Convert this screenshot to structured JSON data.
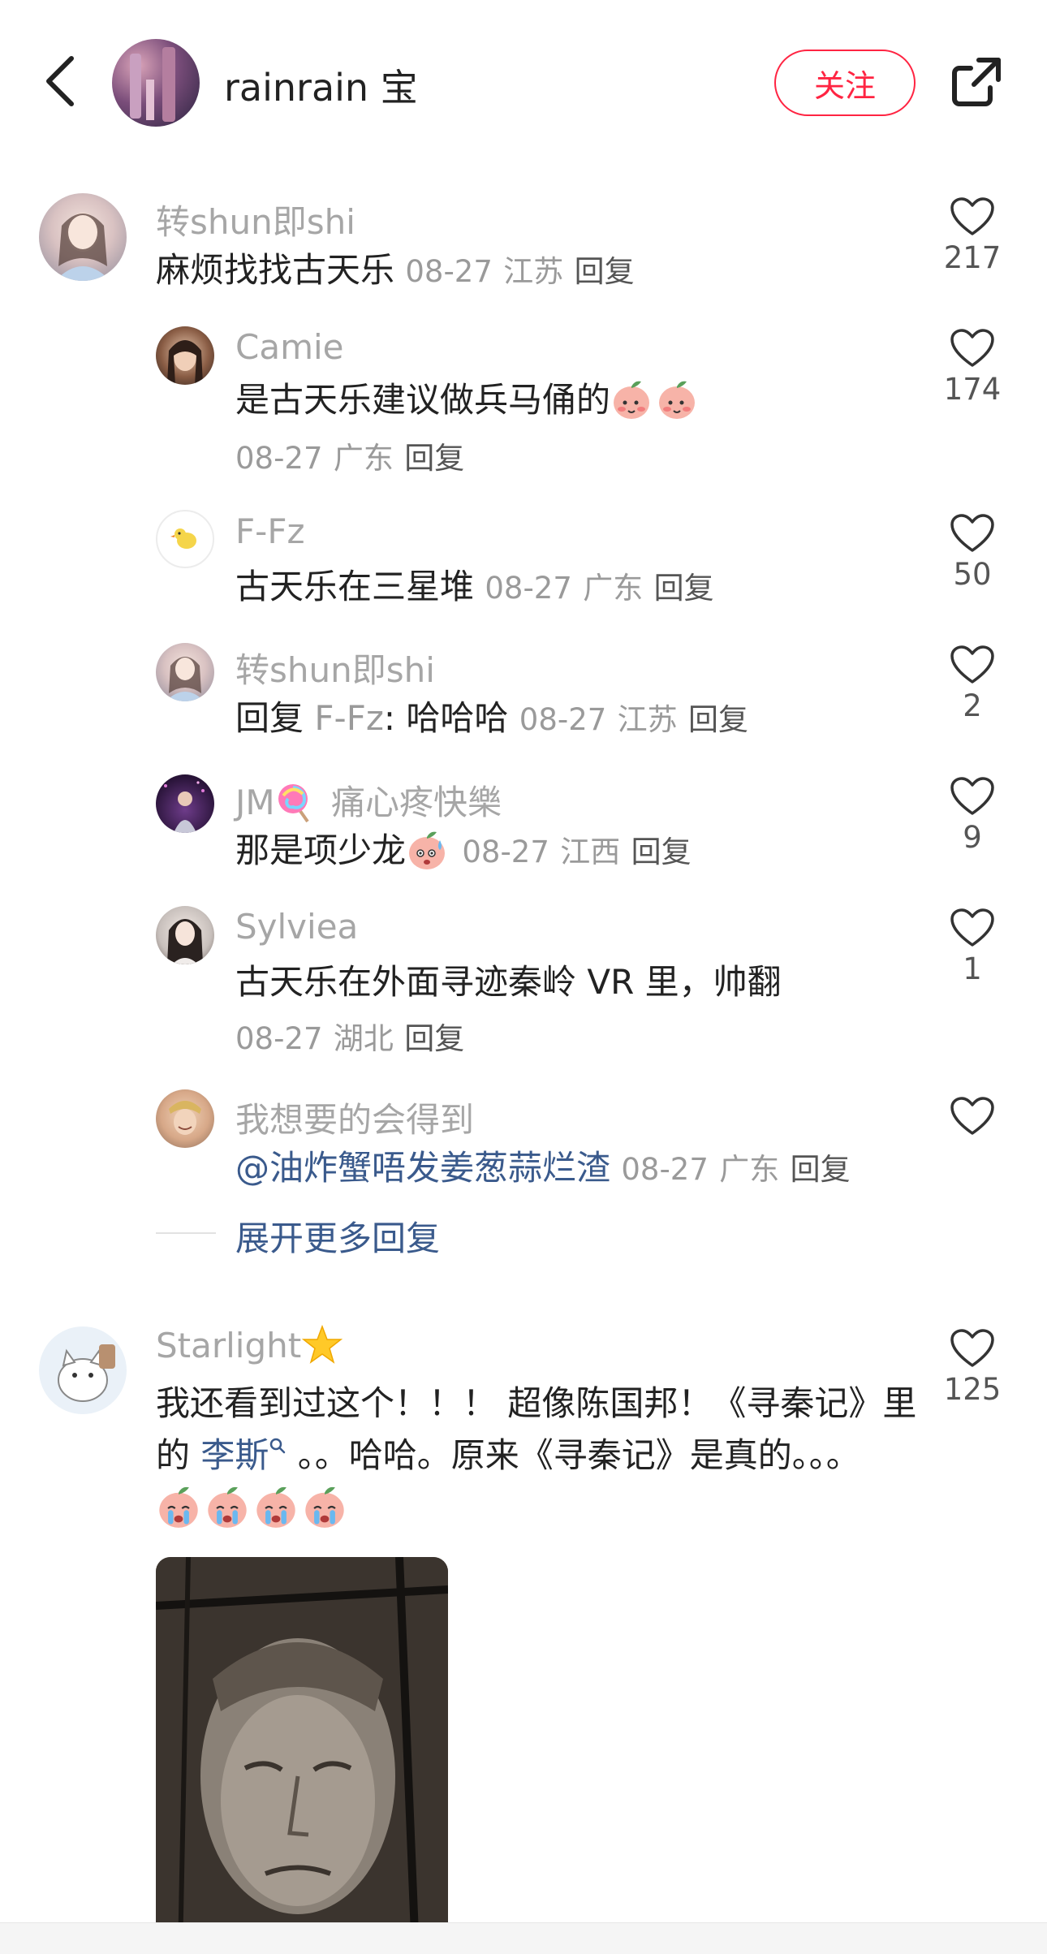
{
  "header": {
    "name": "rainrain 宝",
    "follow_label": "关注"
  },
  "comments": [
    {
      "username": "转shun即shi",
      "text": "麻烦找找古天乐",
      "date": "08-27",
      "location": "江苏",
      "reply_label": "回复",
      "likes": "217",
      "replies": [
        {
          "username": "Camie",
          "text": "是古天乐建议做兵马俑的",
          "date": "08-27",
          "location": "广东",
          "reply_label": "回复",
          "likes": "174"
        },
        {
          "username": "F-Fz",
          "text": "古天乐在三星堆",
          "date": "08-27",
          "location": "广东",
          "reply_label": "回复",
          "likes": "50"
        },
        {
          "username": "转shun即shi",
          "reply_prefix": "回复",
          "reply_target": "F-Fz",
          "text": ": 哈哈哈",
          "date": "08-27",
          "location": "江苏",
          "reply_label": "回复",
          "likes": "2"
        },
        {
          "username_a": "JM",
          "username_b": "痛心疼快樂",
          "text": "那是项少龙",
          "date": "08-27",
          "location": "江西",
          "reply_label": "回复",
          "likes": "9"
        },
        {
          "username": "Sylviea",
          "text": "古天乐在外面寻迹秦岭 VR 里，帅翻",
          "date": "08-27",
          "location": "湖北",
          "reply_label": "回复",
          "likes": "1"
        },
        {
          "username": "我想要的会得到",
          "mention": "@油炸蟹唔发姜葱蒜烂渣",
          "date": "08-27",
          "location": "广东",
          "reply_label": "回复",
          "likes": ""
        }
      ],
      "expand_label": "展开更多回复"
    },
    {
      "username": "Starlight",
      "text_line1": "我还看到过这个！！！ 超像陈国邦！《寻秦记》里",
      "text_line2_prefix": "的 ",
      "text_line2_mention": "李斯",
      "text_line2_suffix": " 。。哈哈。原来《寻秦记》是真的。。。",
      "likes": "125"
    }
  ]
}
